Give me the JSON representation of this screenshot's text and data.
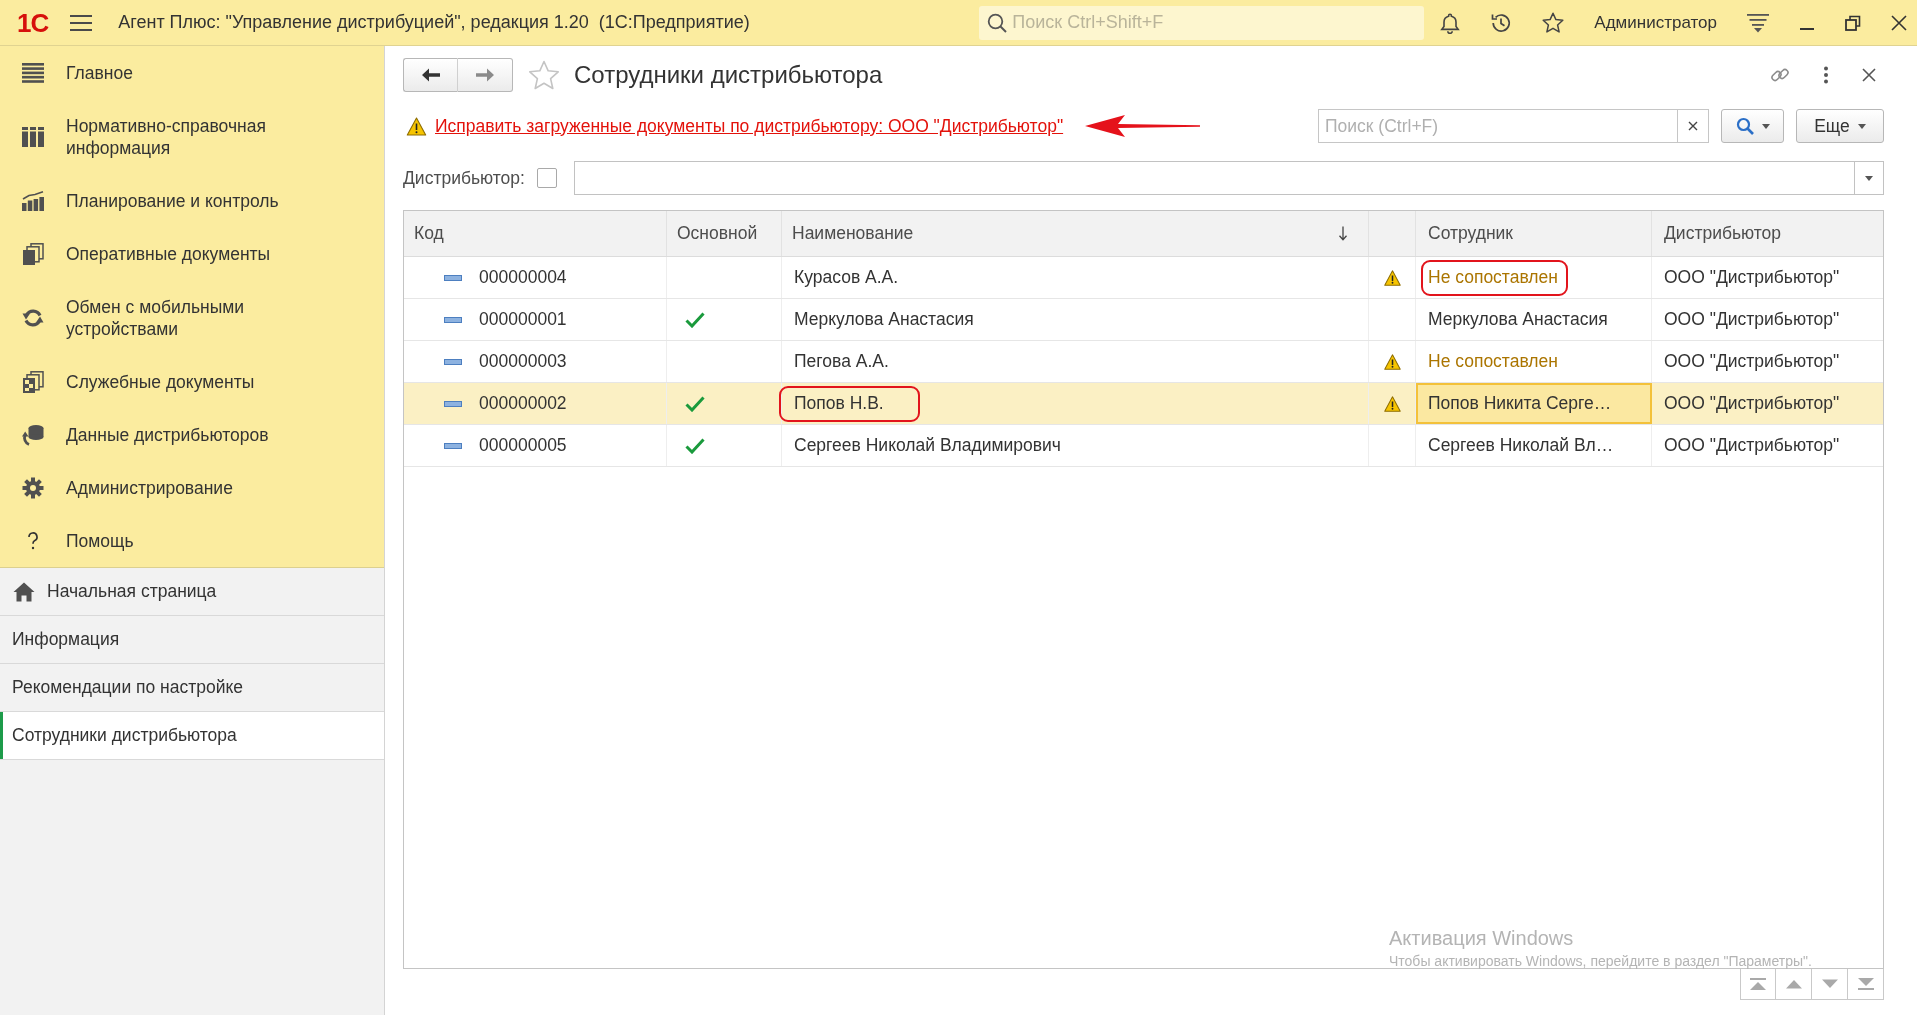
{
  "app_bar": {
    "logo": "1С",
    "title": "Агент Плюс: \"Управление дистрибуцией\", редакция 1.20  (1С:Предприятие)",
    "search": {
      "placeholder": "Поиск Ctrl+Shift+F"
    },
    "user": "Администратор"
  },
  "sidebar": {
    "sections": [
      {
        "kind": "main",
        "label": "Главное"
      },
      {
        "kind": "catalog",
        "label": "Нормативно-справочная информация"
      },
      {
        "kind": "planning",
        "label": "Планирование и контроль"
      },
      {
        "kind": "operations",
        "label": "Оперативные документы"
      },
      {
        "kind": "exchange",
        "label": "Обмен с мобильными устройствами"
      },
      {
        "kind": "service",
        "label": "Служебные документы"
      },
      {
        "kind": "distributors",
        "label": "Данные дистрибьюторов"
      },
      {
        "kind": "admin",
        "label": "Администрирование"
      },
      {
        "kind": "help",
        "label": "Помощь"
      }
    ],
    "open_windows": [
      {
        "kind": "home",
        "label": "Начальная страница",
        "selected": false
      },
      {
        "kind": "page",
        "label": "Информация",
        "selected": false
      },
      {
        "kind": "page",
        "label": "Рекомендации по настройке",
        "selected": false
      },
      {
        "kind": "page",
        "label": "Сотрудники дистрибьютора",
        "selected": true
      }
    ]
  },
  "form": {
    "title": "Сотрудники дистрибьютора",
    "warning_link": "Исправить загруженные документы по дистрибьютору: ООО \"Дистрибьютор\"",
    "search": {
      "placeholder": "Поиск (Ctrl+F)"
    },
    "more_button": "Еще",
    "filter": {
      "label": "Дистрибьютор:",
      "checked": false
    }
  },
  "table": {
    "columns": [
      {
        "label": "Код",
        "sorted": false
      },
      {
        "label": "Основной",
        "sorted": false
      },
      {
        "label": "Наименование",
        "sorted": true
      },
      {
        "label": "Сотрудник",
        "sorted": false
      },
      {
        "label": "Дистрибьютор",
        "sorted": false
      }
    ],
    "rows": [
      {
        "code": "000000004",
        "main": false,
        "name": "Курасов А.А.",
        "warning": true,
        "employee": "Не сопоставлен",
        "employee_mapped": false,
        "distributor": "ООО \"Дистрибьютор\"",
        "selected": false,
        "name_circled": false,
        "employee_circled": true
      },
      {
        "code": "000000001",
        "main": true,
        "name": "Меркулова Анастасия",
        "warning": false,
        "employee": "Меркулова Анастасия",
        "employee_mapped": true,
        "distributor": "ООО \"Дистрибьютор\"",
        "selected": false,
        "name_circled": false,
        "employee_circled": false
      },
      {
        "code": "000000003",
        "main": false,
        "name": "Пегова А.А.",
        "warning": true,
        "employee": "Не сопоставлен",
        "employee_mapped": false,
        "distributor": "ООО \"Дистрибьютор\"",
        "selected": false,
        "name_circled": false,
        "employee_circled": false
      },
      {
        "code": "000000002",
        "main": true,
        "name": "Попов Н.В.",
        "warning": true,
        "employee": "Попов Никита Серге…",
        "employee_mapped": true,
        "distributor": "ООО \"Дистрибьютор\"",
        "selected": true,
        "name_circled": true,
        "employee_circled": false
      },
      {
        "code": "000000005",
        "main": true,
        "name": "Сергеев Николай Владимирович",
        "warning": false,
        "employee": "Сергеев Николай Вл…",
        "employee_mapped": true,
        "distributor": "ООО \"Дистрибьютор\"",
        "selected": false,
        "name_circled": false,
        "employee_circled": false
      }
    ]
  },
  "os_notice": {
    "title": "Активация Windows",
    "text": "Чтобы активировать Windows, перейдите в раздел \"Параметры\"."
  }
}
